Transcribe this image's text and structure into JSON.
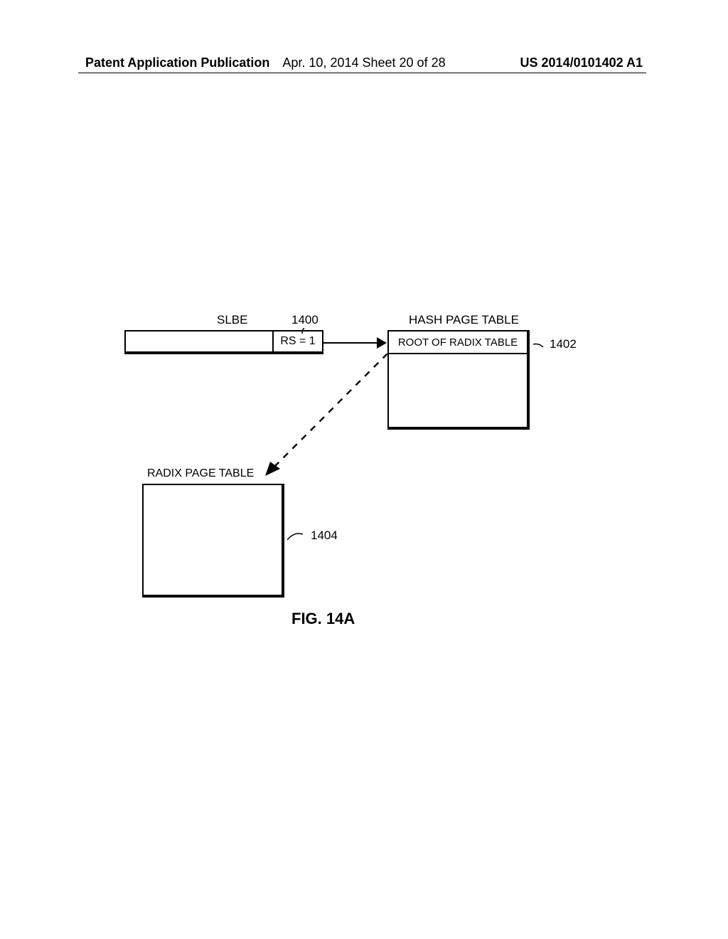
{
  "header": {
    "left": "Patent Application Publication",
    "center": "Apr. 10, 2014  Sheet 20 of 28",
    "right": "US 2014/0101402 A1"
  },
  "diagram": {
    "slbe_label": "SLBE",
    "ref_1400": "1400",
    "rs_value": "RS = 1",
    "hash_label": "HASH PAGE TABLE",
    "hash_row_text": "ROOT OF RADIX TABLE",
    "ref_1402": "1402",
    "radix_label": "RADIX PAGE TABLE",
    "ref_1404": "1404",
    "figure_label": "FIG. 14A"
  }
}
